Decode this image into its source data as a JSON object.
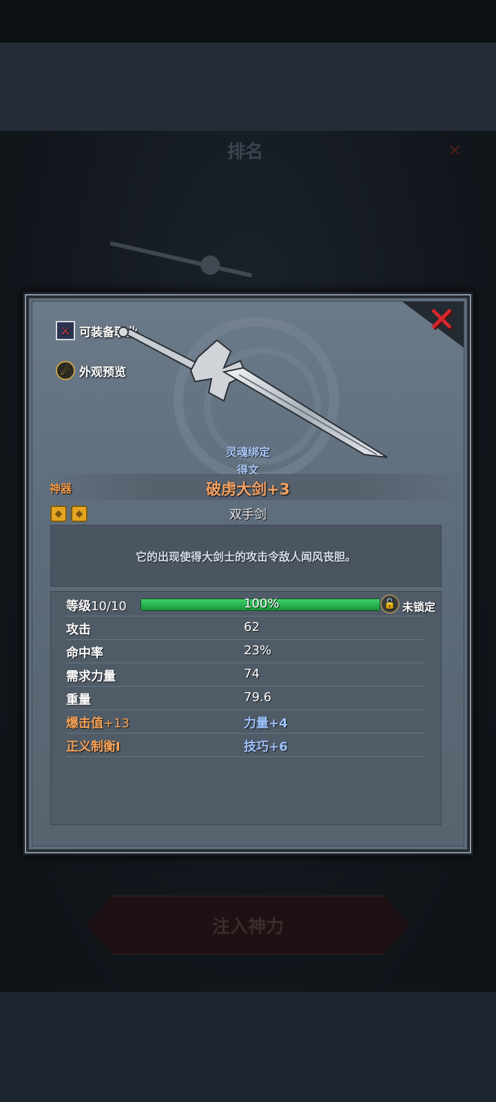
{
  "background": {
    "title": "排名",
    "action_label": "注入神力"
  },
  "panel": {
    "links": {
      "jobs": "可装备职业",
      "appearance": "外观预览"
    },
    "close_icon": "close-x-icon",
    "bind_status": "灵魂绑定",
    "bind_owner": "得文",
    "tier": "神器",
    "item_name": "破虏大剑+3",
    "item_type": "双手剑",
    "description": "它的出现使得大剑士的攻击令敌人闻风丧胆。",
    "gems": [
      "gem-icon",
      "gem-icon"
    ],
    "colors": {
      "name_orange": "#f4a162",
      "bound_blue": "#a9c6f2",
      "close_red": "#d6272d",
      "exp_green": "#3fd26a"
    }
  },
  "stats": {
    "level_label": "等级",
    "level_value": "10/10",
    "exp_percent_text": "100%",
    "exp_progress": 1.0,
    "lock_label": "未锁定",
    "rows": [
      {
        "label": "攻击",
        "value": "62"
      },
      {
        "label": "命中率",
        "value": "23%"
      },
      {
        "label": "需求力量",
        "value": "74"
      },
      {
        "label": "重量",
        "value": "79.6"
      }
    ],
    "bonus": [
      {
        "label": "爆击值",
        "label_suffix": "+13",
        "value": "力量+4"
      },
      {
        "label": "正义制衡I",
        "value": "技巧+6"
      }
    ]
  }
}
